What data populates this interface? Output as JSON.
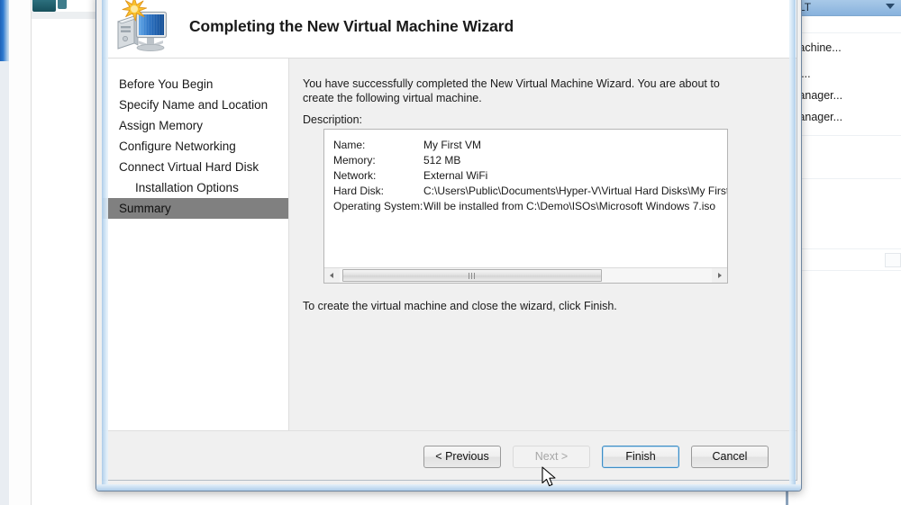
{
  "background": {
    "right_window": {
      "title": "-LT",
      "items": [
        "Machine...",
        "gs...",
        "Manager...",
        "Manager..."
      ]
    }
  },
  "dialog": {
    "title": "Completing the New Virtual Machine Wizard",
    "header_icon": "new-virtual-machine-icon",
    "sidebar": {
      "items": [
        {
          "label": "Before You Begin",
          "indent": false,
          "active": false
        },
        {
          "label": "Specify Name and Location",
          "indent": false,
          "active": false
        },
        {
          "label": "Assign Memory",
          "indent": false,
          "active": false
        },
        {
          "label": "Configure Networking",
          "indent": false,
          "active": false
        },
        {
          "label": "Connect Virtual Hard Disk",
          "indent": false,
          "active": false
        },
        {
          "label": "Installation Options",
          "indent": true,
          "active": false
        },
        {
          "label": "Summary",
          "indent": false,
          "active": true
        }
      ]
    },
    "content": {
      "intro": "You have successfully completed the New Virtual Machine Wizard. You are about to create the following virtual machine.",
      "description_label": "Description:",
      "summary_rows": [
        {
          "key": "Name:",
          "value": "My First VM"
        },
        {
          "key": "Memory:",
          "value": "512 MB"
        },
        {
          "key": "Network:",
          "value": "External WiFi"
        },
        {
          "key": "Hard Disk:",
          "value": "C:\\Users\\Public\\Documents\\Hyper-V\\Virtual Hard Disks\\My First V"
        },
        {
          "key": "Operating System:",
          "value": "Will be installed from C:\\Demo\\ISOs\\Microsoft Windows 7.iso"
        }
      ],
      "footnote": "To create the virtual machine and close the wizard, click Finish.",
      "scrollbar": {
        "left_arrow_icon": "scroll-left-arrow-icon",
        "right_arrow_icon": "scroll-right-arrow-icon",
        "thumb_grip_icon": "scrollbar-grip-icon"
      }
    },
    "footer": {
      "previous_label": "< Previous",
      "next_label": "Next >",
      "finish_label": "Finish",
      "cancel_label": "Cancel"
    }
  },
  "colors": {
    "accent_default_button": "#3c8dc5",
    "sidebar_active": "#808080",
    "dialog_bg": "#f0f0f0",
    "frame_glass": "#adcdea"
  }
}
